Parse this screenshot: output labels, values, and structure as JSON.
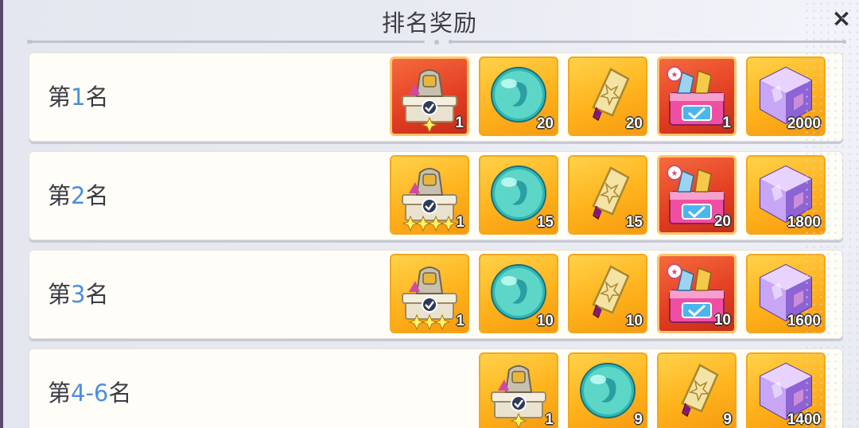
{
  "title": "排名奖励",
  "close_label": "×",
  "rows": [
    {
      "prefix": "第",
      "rank": "1",
      "suffix": "名",
      "rewards": [
        {
          "icon": "hero-chest-icon",
          "qty": "1",
          "bg": "red",
          "stars": 1
        },
        {
          "icon": "spirit-orb-icon",
          "qty": "20",
          "bg": "gold"
        },
        {
          "icon": "scroll-tag-icon",
          "qty": "20",
          "bg": "gold"
        },
        {
          "icon": "gift-box-icon",
          "qty": "1",
          "bg": "red"
        },
        {
          "icon": "crystal-cube-icon",
          "qty": "2000",
          "bg": "gold"
        }
      ]
    },
    {
      "prefix": "第",
      "rank": "2",
      "suffix": "名",
      "rewards": [
        {
          "icon": "hero-chest-icon",
          "qty": "1",
          "bg": "gold",
          "stars": 4
        },
        {
          "icon": "spirit-orb-icon",
          "qty": "15",
          "bg": "gold"
        },
        {
          "icon": "scroll-tag-icon",
          "qty": "15",
          "bg": "gold"
        },
        {
          "icon": "gift-box-icon",
          "qty": "20",
          "bg": "red"
        },
        {
          "icon": "crystal-cube-icon",
          "qty": "1800",
          "bg": "gold"
        }
      ]
    },
    {
      "prefix": "第",
      "rank": "3",
      "suffix": "名",
      "rewards": [
        {
          "icon": "hero-chest-icon",
          "qty": "1",
          "bg": "gold",
          "stars": 3
        },
        {
          "icon": "spirit-orb-icon",
          "qty": "10",
          "bg": "gold"
        },
        {
          "icon": "scroll-tag-icon",
          "qty": "10",
          "bg": "gold"
        },
        {
          "icon": "gift-box-icon",
          "qty": "10",
          "bg": "red"
        },
        {
          "icon": "crystal-cube-icon",
          "qty": "1600",
          "bg": "gold"
        }
      ]
    },
    {
      "prefix": "第",
      "rank": "4-6",
      "suffix": "名",
      "rewards": [
        {
          "icon": "hero-chest-icon",
          "qty": "1",
          "bg": "gold",
          "stars": 1
        },
        {
          "icon": "spirit-orb-icon",
          "qty": "9",
          "bg": "gold"
        },
        {
          "icon": "scroll-tag-icon",
          "qty": "9",
          "bg": "gold"
        },
        {
          "icon": "crystal-cube-icon",
          "qty": "1400",
          "bg": "gold"
        }
      ]
    }
  ],
  "colors": {
    "rank_number": "#4a8fe0",
    "gold_tile": "#ffb21c",
    "red_tile": "#e23c22"
  }
}
